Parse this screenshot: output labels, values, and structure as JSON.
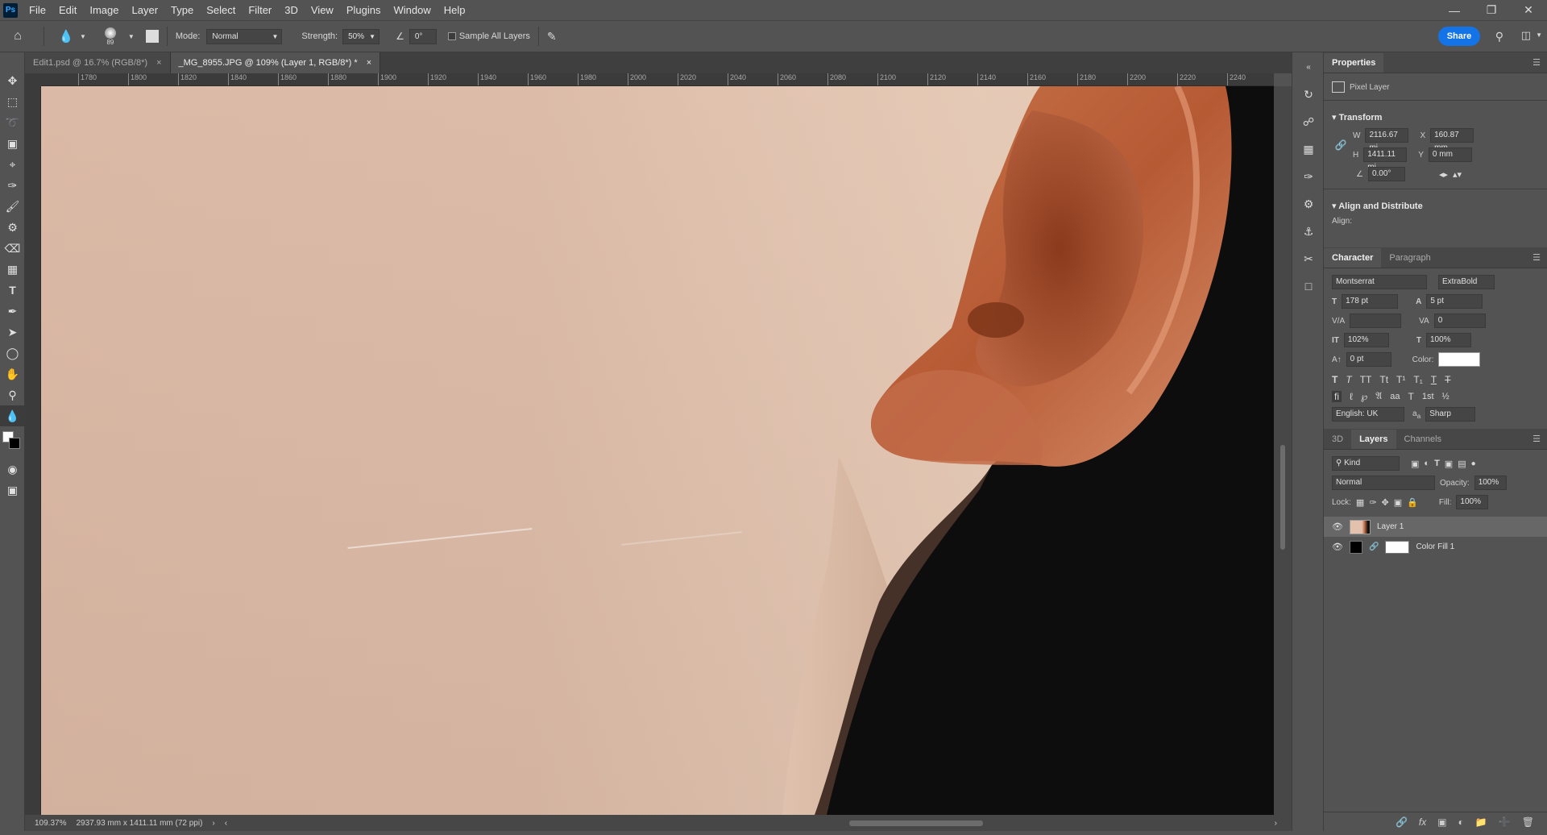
{
  "menu": [
    "File",
    "Edit",
    "Image",
    "Layer",
    "Type",
    "Select",
    "Filter",
    "3D",
    "View",
    "Plugins",
    "Window",
    "Help"
  ],
  "logo": "Ps",
  "options": {
    "brush_size": "89",
    "mode_label": "Mode:",
    "mode_value": "Normal",
    "strength_label": "Strength:",
    "strength_value": "50%",
    "angle_value": "0°",
    "sample_all_layers": "Sample All Layers",
    "share": "Share"
  },
  "tabs": [
    {
      "label": "Edit1.psd @ 16.7% (RGB/8*)"
    },
    {
      "label": "_MG_8955.JPG @ 109% (Layer 1, RGB/8*) *"
    }
  ],
  "ruler_ticks": [
    "1780",
    "1800",
    "1820",
    "1840",
    "1860",
    "1880",
    "1900",
    "1920",
    "1940",
    "1960",
    "1980",
    "2000",
    "2020",
    "2040",
    "2060",
    "2080",
    "2100",
    "2120",
    "2140",
    "2160",
    "2180",
    "2200",
    "2220",
    "2240"
  ],
  "status": {
    "zoom": "109.37%",
    "doc_size": "2937.93 mm x 1411.11 mm (72 ppi)"
  },
  "properties": {
    "tab": "Properties",
    "layer_type": "Pixel Layer",
    "transform_title": "Transform",
    "w_label": "W",
    "w_value": "2116.67 mi",
    "x_label": "X",
    "x_value": "160.87 mm",
    "h_label": "H",
    "h_value": "1411.11 mi",
    "y_label": "Y",
    "y_value": "0 mm",
    "angle_value": "0.00°",
    "align_title": "Align and Distribute",
    "align_label": "Align:"
  },
  "character": {
    "tab_character": "Character",
    "tab_paragraph": "Paragraph",
    "font_family": "Montserrat",
    "font_style": "ExtraBold",
    "font_size": "178 pt",
    "leading": "5 pt",
    "kerning": "",
    "tracking": "0",
    "vertical_scale": "102%",
    "horizontal_scale": "100%",
    "baseline_shift": "0 pt",
    "color_label": "Color:",
    "language": "English: UK",
    "antialias_prefix": "a",
    "antialias_suffix": "a",
    "antialias": "Sharp"
  },
  "layers": {
    "tab_3d": "3D",
    "tab_layers": "Layers",
    "tab_channels": "Channels",
    "filter_kind": "Kind",
    "blend_mode": "Normal",
    "opacity_label": "Opacity:",
    "opacity_value": "100%",
    "lock_label": "Lock:",
    "fill_label": "Fill:",
    "fill_value": "100%",
    "items": [
      {
        "name": "Layer 1"
      },
      {
        "name": "Color Fill 1"
      }
    ]
  }
}
